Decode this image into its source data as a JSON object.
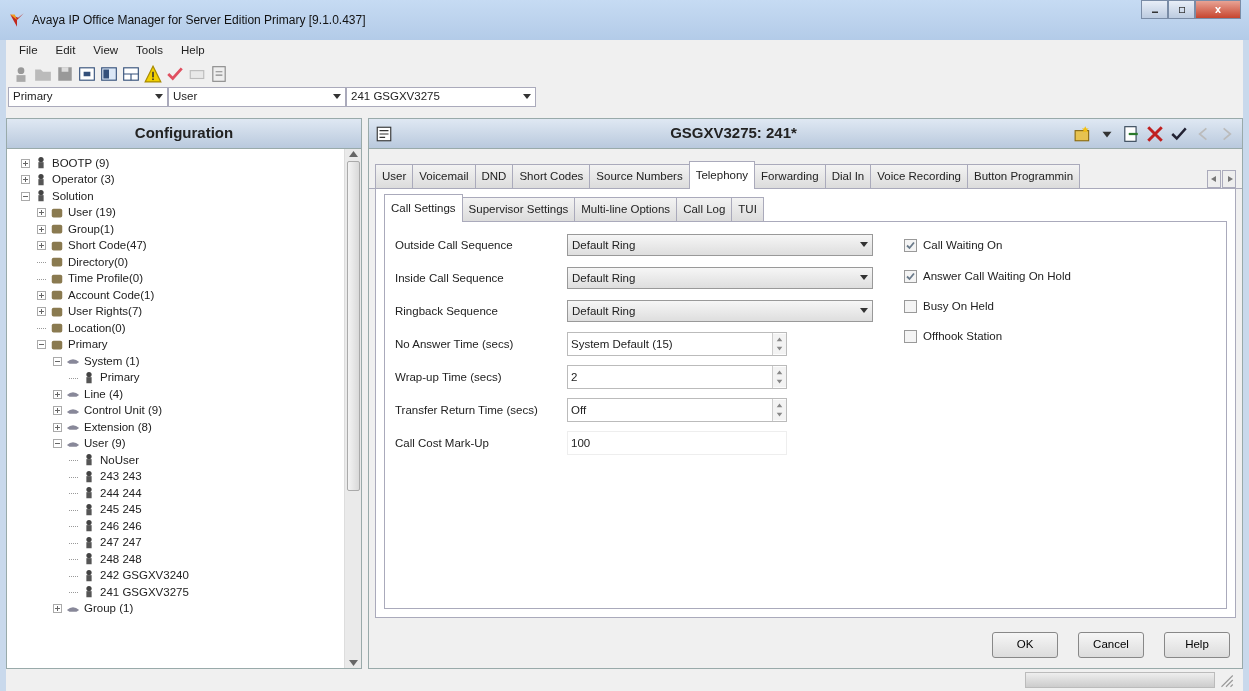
{
  "window": {
    "title": "Avaya IP Office Manager for Server Edition Primary [9.1.0.437]"
  },
  "menu": [
    "File",
    "Edit",
    "View",
    "Tools",
    "Help"
  ],
  "selectors": [
    {
      "value": "Primary"
    },
    {
      "value": "User"
    },
    {
      "value": "241 GSGXV3275"
    }
  ],
  "sidebar": {
    "title": "Configuration",
    "tree": [
      {
        "label": "BOOTP (9)",
        "kind": "branch",
        "expanded": false
      },
      {
        "label": "Operator (3)",
        "kind": "branch",
        "expanded": false
      },
      {
        "label": "Solution",
        "kind": "branch",
        "expanded": true,
        "children": [
          {
            "label": "User (19)",
            "kind": "branch",
            "expanded": false
          },
          {
            "label": "Group(1)",
            "kind": "branch",
            "expanded": false
          },
          {
            "label": "Short Code(47)",
            "kind": "branch",
            "expanded": false
          },
          {
            "label": "Directory(0)",
            "kind": "leaf"
          },
          {
            "label": "Time Profile(0)",
            "kind": "leaf"
          },
          {
            "label": "Account Code(1)",
            "kind": "branch",
            "expanded": false
          },
          {
            "label": "User Rights(7)",
            "kind": "branch",
            "expanded": false
          },
          {
            "label": "Location(0)",
            "kind": "leaf"
          },
          {
            "label": "Primary",
            "kind": "branch",
            "expanded": true,
            "children": [
              {
                "label": "System (1)",
                "kind": "branch",
                "expanded": true,
                "children": [
                  {
                    "label": "Primary",
                    "kind": "leaf"
                  }
                ]
              },
              {
                "label": "Line (4)",
                "kind": "branch",
                "expanded": false
              },
              {
                "label": "Control Unit (9)",
                "kind": "branch",
                "expanded": false
              },
              {
                "label": "Extension (8)",
                "kind": "branch",
                "expanded": false
              },
              {
                "label": "User (9)",
                "kind": "branch",
                "expanded": true,
                "children": [
                  {
                    "label": "NoUser",
                    "kind": "leaf"
                  },
                  {
                    "label": "243 243",
                    "kind": "leaf"
                  },
                  {
                    "label": "244 244",
                    "kind": "leaf"
                  },
                  {
                    "label": "245 245",
                    "kind": "leaf"
                  },
                  {
                    "label": "246 246",
                    "kind": "leaf"
                  },
                  {
                    "label": "247 247",
                    "kind": "leaf"
                  },
                  {
                    "label": "248 248",
                    "kind": "leaf"
                  },
                  {
                    "label": "242 GSGXV3240",
                    "kind": "leaf"
                  },
                  {
                    "label": "241 GSGXV3275",
                    "kind": "leaf"
                  }
                ]
              },
              {
                "label": "Group (1)",
                "kind": "branch",
                "expanded": false
              }
            ]
          }
        ]
      }
    ]
  },
  "editor": {
    "title": "GSGXV3275: 241*",
    "tabs": [
      {
        "label": "User",
        "selected": false
      },
      {
        "label": "Voicemail",
        "selected": false
      },
      {
        "label": "DND",
        "selected": false
      },
      {
        "label": "Short Codes",
        "selected": false
      },
      {
        "label": "Source Numbers",
        "selected": false
      },
      {
        "label": "Telephony",
        "selected": true
      },
      {
        "label": "Forwarding",
        "selected": false
      },
      {
        "label": "Dial In",
        "selected": false
      },
      {
        "label": "Voice Recording",
        "selected": false
      },
      {
        "label": "Button Programmin",
        "selected": false
      }
    ],
    "subtabs": [
      {
        "label": "Call Settings",
        "selected": true
      },
      {
        "label": "Supervisor Settings",
        "selected": false
      },
      {
        "label": "Multi-line Options",
        "selected": false
      },
      {
        "label": "Call Log",
        "selected": false
      },
      {
        "label": "TUI",
        "selected": false
      }
    ],
    "fields": [
      {
        "label": "Outside Call Sequence",
        "kind": "dropdown",
        "value": "Default Ring"
      },
      {
        "label": "Inside Call Sequence",
        "kind": "dropdown",
        "value": "Default Ring"
      },
      {
        "label": "Ringback Sequence",
        "kind": "dropdown",
        "value": "Default Ring"
      },
      {
        "label": "No Answer Time (secs)",
        "kind": "spin",
        "value": "System Default (15)"
      },
      {
        "label": "Wrap-up Time (secs)",
        "kind": "spin",
        "value": "2"
      },
      {
        "label": "Transfer Return Time (secs)",
        "kind": "spin",
        "value": "Off"
      },
      {
        "label": "Call Cost Mark-Up",
        "kind": "text",
        "value": "100"
      }
    ],
    "options": [
      {
        "label": "Call Waiting On",
        "checked": true
      },
      {
        "label": "Answer Call Waiting On Hold",
        "checked": true
      },
      {
        "label": "Busy On Held",
        "checked": false
      },
      {
        "label": "Offhook Station",
        "checked": false
      }
    ],
    "buttons": [
      "OK",
      "Cancel",
      "Help"
    ]
  }
}
